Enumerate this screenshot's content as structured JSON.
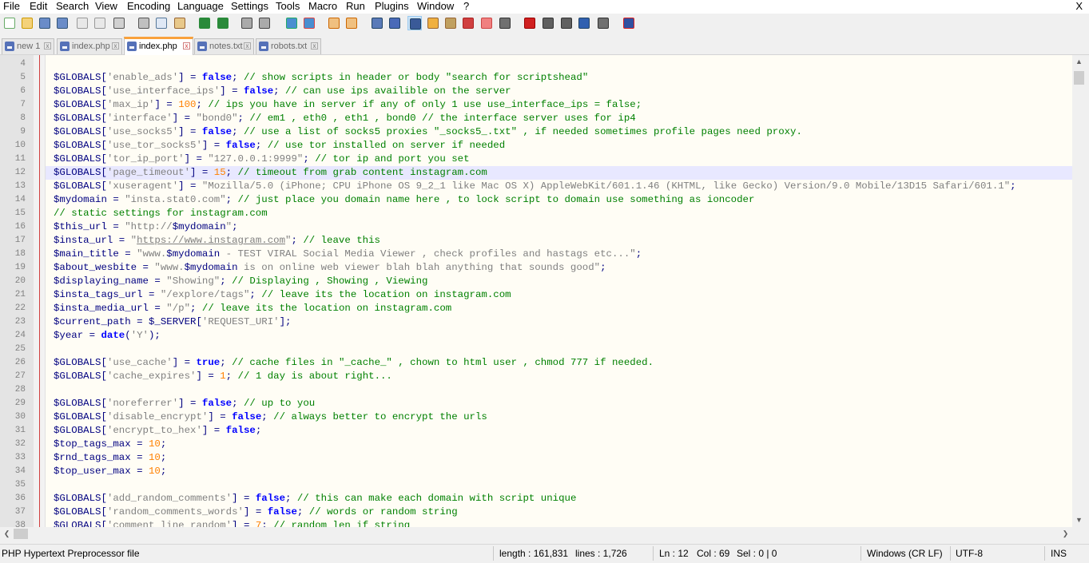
{
  "menu": [
    "File",
    "Edit",
    "Search",
    "View",
    "Encoding",
    "Language",
    "Settings",
    "Tools",
    "Macro",
    "Run",
    "Plugins",
    "Window",
    "?"
  ],
  "close_label": "X",
  "tabs": [
    {
      "label": "new 1",
      "active": false
    },
    {
      "label": "index.php",
      "active": false
    },
    {
      "label": "index.php",
      "active": true
    },
    {
      "label": "notes.txt",
      "active": false
    },
    {
      "label": "robots.txt",
      "active": false
    }
  ],
  "colors": {
    "keyword": "#0000ff",
    "comment": "#008000",
    "string": "#808080",
    "number": "#ff8000",
    "variable": "#000080",
    "operator": "#000080",
    "highlight": "#e8e8ff"
  },
  "current_line": 12,
  "lines": [
    {
      "n": "4",
      "t": []
    },
    {
      "n": "5",
      "t": [
        [
          "v",
          "$GLOBALS"
        ],
        [
          "o",
          "["
        ],
        [
          "s",
          "'enable_ads'"
        ],
        [
          "o",
          "] = "
        ],
        [
          "k",
          "false"
        ],
        [
          "o",
          "; "
        ],
        [
          "c",
          "// show scripts in header or body \"search for scriptshead\""
        ]
      ]
    },
    {
      "n": "6",
      "t": [
        [
          "v",
          "$GLOBALS"
        ],
        [
          "o",
          "["
        ],
        [
          "s",
          "'use_interface_ips'"
        ],
        [
          "o",
          "] = "
        ],
        [
          "k",
          "false"
        ],
        [
          "o",
          "; "
        ],
        [
          "c",
          "// can use ips availible on the server"
        ]
      ]
    },
    {
      "n": "7",
      "t": [
        [
          "v",
          "$GLOBALS"
        ],
        [
          "o",
          "["
        ],
        [
          "s",
          "'max_ip'"
        ],
        [
          "o",
          "] = "
        ],
        [
          "n",
          "100"
        ],
        [
          "o",
          "; "
        ],
        [
          "c",
          "// ips you have in server if any of only 1 use use_interface_ips = false;"
        ]
      ]
    },
    {
      "n": "8",
      "t": [
        [
          "v",
          "$GLOBALS"
        ],
        [
          "o",
          "["
        ],
        [
          "s",
          "'interface'"
        ],
        [
          "o",
          "] = "
        ],
        [
          "s",
          "\"bond0\""
        ],
        [
          "o",
          "; "
        ],
        [
          "c",
          "// em1 , eth0 , eth1 , bond0 // the interface server uses for ip4"
        ]
      ]
    },
    {
      "n": "9",
      "t": [
        [
          "v",
          "$GLOBALS"
        ],
        [
          "o",
          "["
        ],
        [
          "s",
          "'use_socks5'"
        ],
        [
          "o",
          "] = "
        ],
        [
          "k",
          "false"
        ],
        [
          "o",
          "; "
        ],
        [
          "c",
          "// use a list of socks5 proxies \"_socks5_.txt\" , if needed sometimes profile pages need proxy."
        ]
      ]
    },
    {
      "n": "10",
      "t": [
        [
          "v",
          "$GLOBALS"
        ],
        [
          "o",
          "["
        ],
        [
          "s",
          "'use_tor_socks5'"
        ],
        [
          "o",
          "] = "
        ],
        [
          "k",
          "false"
        ],
        [
          "o",
          "; "
        ],
        [
          "c",
          "// use tor installed on server if needed"
        ]
      ]
    },
    {
      "n": "11",
      "t": [
        [
          "v",
          "$GLOBALS"
        ],
        [
          "o",
          "["
        ],
        [
          "s",
          "'tor_ip_port'"
        ],
        [
          "o",
          "] = "
        ],
        [
          "s",
          "\"127.0.0.1:9999\""
        ],
        [
          "o",
          "; "
        ],
        [
          "c",
          "// tor ip and port you set"
        ]
      ]
    },
    {
      "n": "12",
      "t": [
        [
          "v",
          "$GLOBALS"
        ],
        [
          "o",
          "["
        ],
        [
          "s",
          "'page_timeout'"
        ],
        [
          "o",
          "] = "
        ],
        [
          "n",
          "15"
        ],
        [
          "o",
          "; "
        ],
        [
          "c",
          "// timeout from grab content instagram.com"
        ]
      ]
    },
    {
      "n": "13",
      "t": [
        [
          "v",
          "$GLOBALS"
        ],
        [
          "o",
          "["
        ],
        [
          "s",
          "'xuseragent'"
        ],
        [
          "o",
          "] = "
        ],
        [
          "s",
          "\"Mozilla/5.0 (iPhone; CPU iPhone OS 9_2_1 like Mac OS X) AppleWebKit/601.1.46 (KHTML, like Gecko) Version/9.0 Mobile/13D15 Safari/601.1\""
        ],
        [
          "o",
          ";"
        ]
      ]
    },
    {
      "n": "14",
      "t": [
        [
          "v",
          "$mydomain"
        ],
        [
          "o",
          " = "
        ],
        [
          "s",
          "\"insta.stat0.com\""
        ],
        [
          "o",
          "; "
        ],
        [
          "c",
          "// just place you domain name here , to lock script to domain use something as ioncoder"
        ]
      ]
    },
    {
      "n": "15",
      "t": [
        [
          "c",
          "// static settings for instagram.com"
        ]
      ]
    },
    {
      "n": "16",
      "t": [
        [
          "v",
          "$this_url"
        ],
        [
          "o",
          " = "
        ],
        [
          "s",
          "\"http://"
        ],
        [
          "v",
          "$mydomain"
        ],
        [
          "s",
          "\""
        ],
        [
          "o",
          ";"
        ]
      ]
    },
    {
      "n": "17",
      "t": [
        [
          "v",
          "$insta_url"
        ],
        [
          "o",
          " = "
        ],
        [
          "s",
          "\""
        ],
        [
          "u",
          "https://www.instagram.com"
        ],
        [
          "s",
          "\""
        ],
        [
          "o",
          "; "
        ],
        [
          "c",
          "// leave this"
        ]
      ]
    },
    {
      "n": "18",
      "t": [
        [
          "v",
          "$main_title"
        ],
        [
          "o",
          " = "
        ],
        [
          "s",
          "\"www."
        ],
        [
          "v",
          "$mydomain"
        ],
        [
          "s",
          " - TEST VIRAL Social Media Viewer , check profiles and hastags etc...\""
        ],
        [
          "o",
          ";"
        ]
      ]
    },
    {
      "n": "19",
      "t": [
        [
          "v",
          "$about_wesbite"
        ],
        [
          "o",
          " = "
        ],
        [
          "s",
          "\"www."
        ],
        [
          "v",
          "$mydomain"
        ],
        [
          "s",
          " is on online web viewer blah blah anything that sounds good\""
        ],
        [
          "o",
          ";"
        ]
      ]
    },
    {
      "n": "20",
      "t": [
        [
          "v",
          "$displaying_name"
        ],
        [
          "o",
          " = "
        ],
        [
          "s",
          "\"Showing\""
        ],
        [
          "o",
          "; "
        ],
        [
          "c",
          "// Displaying , Showing , Viewing"
        ]
      ]
    },
    {
      "n": "21",
      "t": [
        [
          "v",
          "$insta_tags_url"
        ],
        [
          "o",
          " = "
        ],
        [
          "s",
          "\"/explore/tags\""
        ],
        [
          "o",
          "; "
        ],
        [
          "c",
          "// leave its the location on instagram.com"
        ]
      ]
    },
    {
      "n": "22",
      "t": [
        [
          "v",
          "$insta_media_url"
        ],
        [
          "o",
          " = "
        ],
        [
          "s",
          "\"/p\""
        ],
        [
          "o",
          "; "
        ],
        [
          "c",
          "// leave its the location on instagram.com"
        ]
      ]
    },
    {
      "n": "23",
      "t": [
        [
          "v",
          "$current_path"
        ],
        [
          "o",
          " = "
        ],
        [
          "v",
          "$_SERVER"
        ],
        [
          "o",
          "["
        ],
        [
          "s",
          "'REQUEST_URI'"
        ],
        [
          "o",
          "];"
        ]
      ]
    },
    {
      "n": "24",
      "t": [
        [
          "v",
          "$year"
        ],
        [
          "o",
          " = "
        ],
        [
          "k",
          "date"
        ],
        [
          "o",
          "("
        ],
        [
          "s",
          "'Y'"
        ],
        [
          "o",
          ");"
        ]
      ]
    },
    {
      "n": "25",
      "t": []
    },
    {
      "n": "26",
      "t": [
        [
          "v",
          "$GLOBALS"
        ],
        [
          "o",
          "["
        ],
        [
          "s",
          "'use_cache'"
        ],
        [
          "o",
          "] = "
        ],
        [
          "k",
          "true"
        ],
        [
          "o",
          "; "
        ],
        [
          "c",
          "// cache files in \"_cache_\" , chown to html user , chmod 777 if needed."
        ]
      ]
    },
    {
      "n": "27",
      "t": [
        [
          "v",
          "$GLOBALS"
        ],
        [
          "o",
          "["
        ],
        [
          "s",
          "'cache_expires'"
        ],
        [
          "o",
          "] = "
        ],
        [
          "n",
          "1"
        ],
        [
          "o",
          "; "
        ],
        [
          "c",
          "// 1 day is about right..."
        ]
      ]
    },
    {
      "n": "28",
      "t": []
    },
    {
      "n": "29",
      "t": [
        [
          "v",
          "$GLOBALS"
        ],
        [
          "o",
          "["
        ],
        [
          "s",
          "'noreferrer'"
        ],
        [
          "o",
          "] = "
        ],
        [
          "k",
          "false"
        ],
        [
          "o",
          "; "
        ],
        [
          "c",
          "// up to you"
        ]
      ]
    },
    {
      "n": "30",
      "t": [
        [
          "v",
          "$GLOBALS"
        ],
        [
          "o",
          "["
        ],
        [
          "s",
          "'disable_encrypt'"
        ],
        [
          "o",
          "] = "
        ],
        [
          "k",
          "false"
        ],
        [
          "o",
          "; "
        ],
        [
          "c",
          "// always better to encrypt the urls"
        ]
      ]
    },
    {
      "n": "31",
      "t": [
        [
          "v",
          "$GLOBALS"
        ],
        [
          "o",
          "["
        ],
        [
          "s",
          "'encrypt_to_hex'"
        ],
        [
          "o",
          "] = "
        ],
        [
          "k",
          "false"
        ],
        [
          "o",
          ";"
        ]
      ]
    },
    {
      "n": "32",
      "t": [
        [
          "v",
          "$top_tags_max"
        ],
        [
          "o",
          " = "
        ],
        [
          "n",
          "10"
        ],
        [
          "o",
          ";"
        ]
      ]
    },
    {
      "n": "33",
      "t": [
        [
          "v",
          "$rnd_tags_max"
        ],
        [
          "o",
          " = "
        ],
        [
          "n",
          "10"
        ],
        [
          "o",
          ";"
        ]
      ]
    },
    {
      "n": "34",
      "t": [
        [
          "v",
          "$top_user_max"
        ],
        [
          "o",
          " = "
        ],
        [
          "n",
          "10"
        ],
        [
          "o",
          ";"
        ]
      ]
    },
    {
      "n": "35",
      "t": []
    },
    {
      "n": "36",
      "t": [
        [
          "v",
          "$GLOBALS"
        ],
        [
          "o",
          "["
        ],
        [
          "s",
          "'add_random_comments'"
        ],
        [
          "o",
          "] = "
        ],
        [
          "k",
          "false"
        ],
        [
          "o",
          "; "
        ],
        [
          "c",
          "// this can make each domain with script unique"
        ]
      ]
    },
    {
      "n": "37",
      "t": [
        [
          "v",
          "$GLOBALS"
        ],
        [
          "o",
          "["
        ],
        [
          "s",
          "'random_comments_words'"
        ],
        [
          "o",
          "] = "
        ],
        [
          "k",
          "false"
        ],
        [
          "o",
          "; "
        ],
        [
          "c",
          "// words or random string"
        ]
      ]
    },
    {
      "n": "38",
      "t": [
        [
          "v",
          "$GLOBALS"
        ],
        [
          "o",
          "["
        ],
        [
          "s",
          "'comment_line_random'"
        ],
        [
          "o",
          "] = "
        ],
        [
          "n",
          "7"
        ],
        [
          "o",
          "; "
        ],
        [
          "c",
          "// random len if string"
        ]
      ]
    }
  ],
  "status": {
    "filetype": "PHP Hypertext Preprocessor file",
    "length": "length : 161,831",
    "lines": "lines : 1,726",
    "ln": "Ln : 12",
    "col": "Col : 69",
    "sel": "Sel : 0 | 0",
    "eol": "Windows (CR LF)",
    "encoding": "UTF-8",
    "mode": "INS"
  }
}
